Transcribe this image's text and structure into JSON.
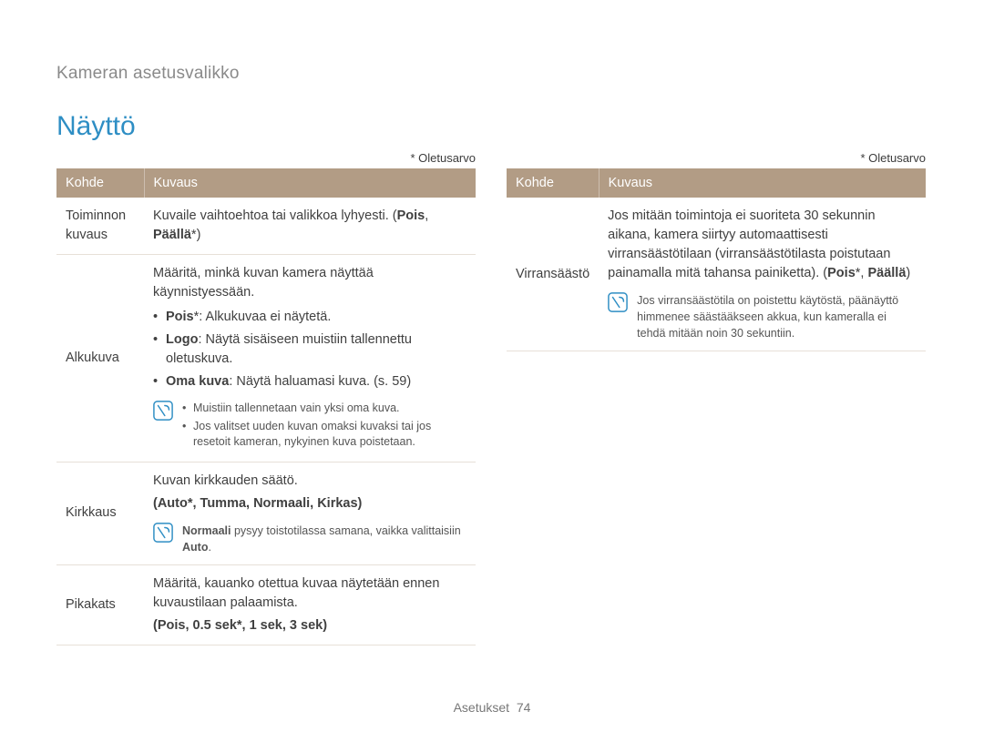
{
  "breadcrumb": "Kameran asetusvalikko",
  "title": "Näyttö",
  "default_note": "* Oletusarvo",
  "headers": {
    "item": "Kohde",
    "desc": "Kuvaus"
  },
  "left": {
    "row1": {
      "label": "Toiminnon kuvaus",
      "desc_a": "Kuvaile vaihtoehtoa tai valikkoa lyhyesti. (",
      "desc_b": "Pois",
      "desc_c": ", ",
      "desc_d": "Päällä",
      "desc_e": "*)"
    },
    "row2": {
      "label": "Alkukuva",
      "intro": "Määritä, minkä kuvan kamera näyttää käynnistyessään.",
      "b1_a": "Pois",
      "b1_b": "*: Alkukuvaa ei näytetä.",
      "b2_a": "Logo",
      "b2_b": ": Näytä sisäiseen muistiin tallennettu oletuskuva.",
      "b3_a": "Oma kuva",
      "b3_b": ": Näytä haluamasi kuva. (s. 59)",
      "n1": "Muistiin tallennetaan vain yksi oma kuva.",
      "n2": "Jos valitset uuden kuvan omaksi kuvaksi tai jos resetoit kameran, nykyinen kuva poistetaan."
    },
    "row3": {
      "label": "Kirkkaus",
      "intro": "Kuvan kirkkauden säätö.",
      "options": "(Auto*, Tumma, Normaali, Kirkas)",
      "note_a": "Normaali",
      "note_b": " pysyy toistotilassa samana, vaikka valittaisiin ",
      "note_c": "Auto",
      "note_d": "."
    },
    "row4": {
      "label": "Pikakats",
      "intro": "Määritä, kauanko otettua kuvaa näytetään ennen kuvaustilaan palaamista.",
      "options": "(Pois, 0.5 sek*, 1 sek, 3 sek)"
    }
  },
  "right": {
    "row1": {
      "label": "Virransäästö",
      "desc_a": "Jos mitään toimintoja ei suoriteta 30 sekunnin aikana, kamera siirtyy automaattisesti virransäästötilaan (virransäästötilasta poistutaan painamalla mitä tahansa painiketta). (",
      "desc_b": "Pois",
      "desc_c": "*, ",
      "desc_d": "Päällä",
      "desc_e": ")",
      "note": "Jos virransäästötila on poistettu käytöstä, päänäyttö himmenee säästääkseen akkua, kun kameralla ei tehdä mitään noin 30 sekuntiin."
    }
  },
  "footer": {
    "section": "Asetukset",
    "page": "74"
  }
}
